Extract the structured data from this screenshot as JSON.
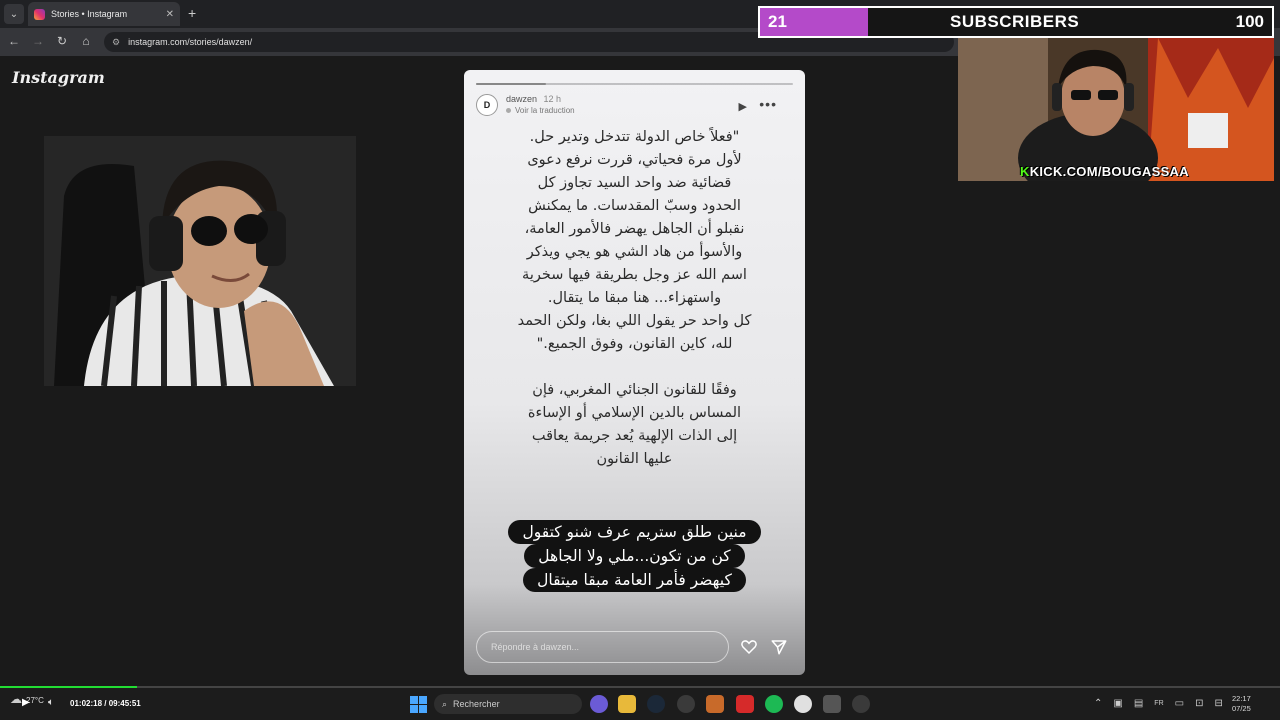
{
  "browser": {
    "tab_title": "Stories • Instagram",
    "url": "instagram.com/stories/dawzen/"
  },
  "instagram": {
    "logo": "Instagram"
  },
  "story": {
    "username": "dawzen",
    "time": "12 h",
    "translate": "Voir la traduction",
    "avatar_letter": "D",
    "progress": 0.22,
    "paragraph1": "\"فعلاً خاص الدولة تتدخل وتدير حل.\nلأول مرة فحياتي، قررت نرفع دعوى\nقضائية ضد واحد السيد تجاوز كل\nالحدود وسبّ المقدسات. ما يمكنش\nنقبلو أن الجاهل يهضر فالأمور العامة،\nوالأسوأ من هاد الشي هو يجي ويذكر\nاسم الله عز وجل بطريقة فيها سخرية\nواستهزاء... هنا مبقا ما يتقال.\nكل واحد حر يقول اللي بغا، ولكن الحمد\nلله، كاين القانون، وفوق الجميع.\"",
    "paragraph2": "وفقًا للقانون الجنائي المغربي، فإن\nالمساس بالدين الإسلامي أو الإساءة\nإلى الذات الإلهية يُعد جريمة يعاقب\nعليها القانون",
    "caption_lines": [
      "منين طلق ستريم عرف شنو كتقول",
      "كن من تكون...ملي ولا الجاهل",
      "كيهضر فأمر العامة مبقا ميتقال"
    ],
    "reply_placeholder": "Répondre à dawzen..."
  },
  "overlay": {
    "sub_count": "21",
    "sub_label": "SUBSCRIBERS",
    "sub_goal": "100",
    "sub_fill": 0.21,
    "kick_prefix": "K",
    "kick_rest": "KICK.COM/BOUGASSAA"
  },
  "taskbar": {
    "weather": "27°C",
    "media_time": "01:02:18 / 09:45:51",
    "media_progress": 0.107,
    "search": "Rechercher",
    "lang": "FR",
    "clock_time": "22:17",
    "clock_date": "07/25"
  },
  "colors": {
    "subscriber_fill": "#b44ac9",
    "kick_green": "#53fc18",
    "media_progress": "#22dd33"
  }
}
